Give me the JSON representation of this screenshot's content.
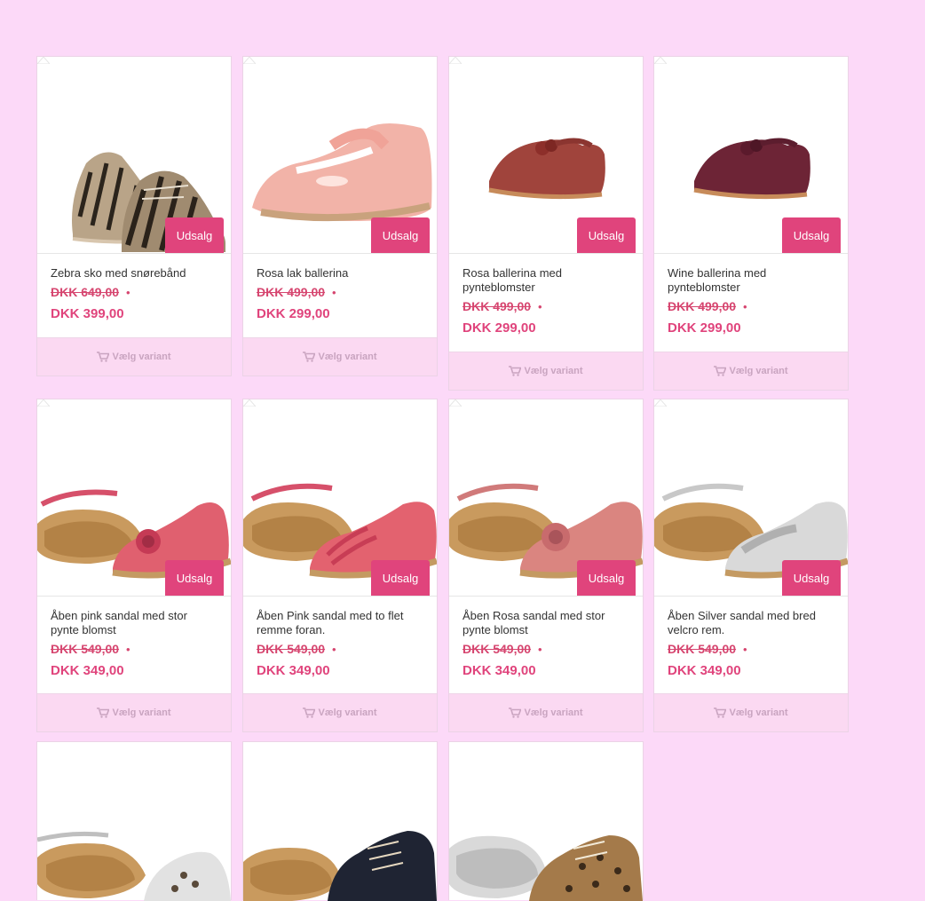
{
  "colors": {
    "background": "#fcd9f8",
    "accent": "#e0447c",
    "variant_bg": "#fbd9f2"
  },
  "products": [
    {
      "name": "Zebra sko med snørebånd",
      "old_price": "DKK 649,00",
      "price": "DKK 399,00",
      "badge": "Udsalg",
      "variant_label": "Vælg variant",
      "image": "zebra-shoes"
    },
    {
      "name": "Rosa lak ballerina",
      "old_price": "DKK 499,00",
      "price": "DKK 299,00",
      "badge": "Udsalg",
      "variant_label": "Vælg variant",
      "image": "pink-patent-ballerina"
    },
    {
      "name": "Rosa ballerina med pynteblomster",
      "old_price": "DKK 499,00",
      "price": "DKK 299,00",
      "badge": "Udsalg",
      "variant_label": "Vælg variant",
      "image": "rose-ballerina"
    },
    {
      "name": "Wine ballerina med pynteblomster",
      "old_price": "DKK 499,00",
      "price": "DKK 299,00",
      "badge": "Udsalg",
      "variant_label": "Vælg variant",
      "image": "wine-ballerina"
    },
    {
      "name": "Åben pink sandal med stor pynte blomst",
      "old_price": "DKK 549,00",
      "price": "DKK 349,00",
      "badge": "Udsalg",
      "variant_label": "Vælg variant",
      "image": "pink-sandal-flower"
    },
    {
      "name": "Åben Pink sandal med to flet remme foran.",
      "old_price": "DKK 549,00",
      "price": "DKK 349,00",
      "badge": "Udsalg",
      "variant_label": "Vælg variant",
      "image": "pink-sandal-braid"
    },
    {
      "name": "Åben Rosa sandal med stor pynte blomst",
      "old_price": "DKK 549,00",
      "price": "DKK 349,00",
      "badge": "Udsalg",
      "variant_label": "Vælg variant",
      "image": "rose-sandal-flower"
    },
    {
      "name": "Åben Silver sandal med bred velcro rem.",
      "old_price": "DKK 549,00",
      "price": "DKK 349,00",
      "badge": "Udsalg",
      "variant_label": "Vælg variant",
      "image": "silver-sandal"
    },
    {
      "image": "silver-leopard-sandal"
    },
    {
      "image": "navy-boot"
    },
    {
      "image": "leopard-sneaker"
    }
  ]
}
